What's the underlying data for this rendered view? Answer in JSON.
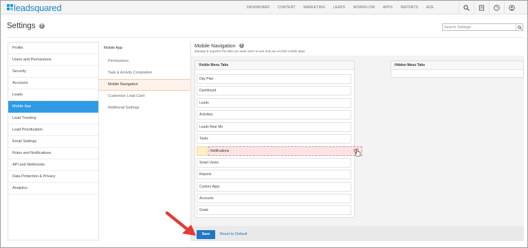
{
  "brand": {
    "name": "leadsquared"
  },
  "nav": {
    "items": [
      "DASHBOARD",
      "CONTENT",
      "MARKETING",
      "LEADS",
      "WORKFLOW",
      "APPS",
      "REPORTS",
      "ACE"
    ],
    "icons": [
      "search-icon",
      "settings-icon",
      "help-icon",
      "user-icon"
    ]
  },
  "header": {
    "title": "Settings",
    "search_placeholder": "Search Settings"
  },
  "sidebar": {
    "items": [
      {
        "label": "Profile"
      },
      {
        "label": "Users and Permissions"
      },
      {
        "label": "Security"
      },
      {
        "label": "Accounts"
      },
      {
        "label": "Leads"
      },
      {
        "label": "Mobile App",
        "active": true
      },
      {
        "label": "Lead Tracking"
      },
      {
        "label": "Lead Prioritization"
      },
      {
        "label": "Email Settings"
      },
      {
        "label": "Rules and Notifications"
      },
      {
        "label": "API and Webhooks"
      },
      {
        "label": "Data Protection & Privacy"
      },
      {
        "label": "Analytics"
      }
    ]
  },
  "submenu": {
    "heading": "Mobile App",
    "items": [
      {
        "label": "Permissions"
      },
      {
        "label": "Task & Activity Completion"
      },
      {
        "label": "Mobile Navigation",
        "active": true
      },
      {
        "label": "Customize Lead Card"
      },
      {
        "label": "Additional Settings"
      }
    ]
  },
  "main": {
    "title": "Mobile Navigation",
    "subtitle": "Manage & organize the tabs you want users to see and use on their mobile apps",
    "visible_panel": {
      "title": "Visible Menu Tabs",
      "items": [
        "Day Plan",
        "Dashboard",
        "Leads",
        "Activities",
        "Leads Near Me",
        "Tasks",
        "Notifications",
        "Smart Views",
        "Reports",
        "Custom Apps",
        "Accounts",
        "Goals"
      ],
      "dragging_index": 6
    },
    "hidden_panel": {
      "title": "Hidden Menu Tabs",
      "items": []
    }
  },
  "footer": {
    "save_label": "Save",
    "reset_label": "Reset to Default"
  },
  "colors": {
    "accent": "#2e9be4",
    "save_button": "#1f78c4",
    "annotation_arrow": "#e53935",
    "drag_highlight": "#fbe4e4"
  }
}
